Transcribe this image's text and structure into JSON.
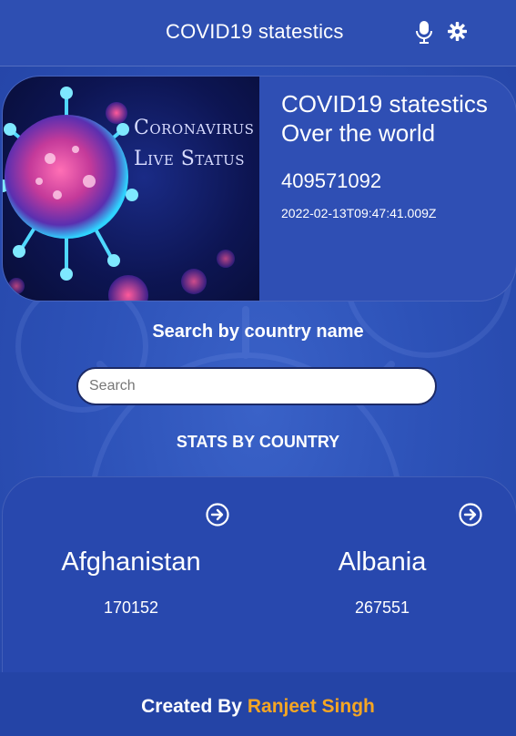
{
  "header": {
    "title": "COVID19 statestics",
    "mic_icon": "microphone-icon",
    "settings_icon": "gear-icon"
  },
  "hero": {
    "banner_line1": "Coronavirus",
    "banner_line2": "Live Status",
    "heading_line1": "COVID19 statestics",
    "heading_line2": "Over the world",
    "total_cases": "409571092",
    "updated": "2022-02-13T09:47:41.009Z"
  },
  "search": {
    "label": "Search by country name",
    "placeholder": "Search",
    "value": ""
  },
  "stats": {
    "label": "STATS BY COUNTRY",
    "countries": [
      {
        "name": "Afghanistan",
        "cases": "170152",
        "icon": "arrow-right-circle-icon"
      },
      {
        "name": "Albania",
        "cases": "267551",
        "icon": "arrow-right-circle-icon"
      }
    ]
  },
  "footer": {
    "prefix": "Created By",
    "author": "Ranjeet Singh"
  },
  "colors": {
    "background": "#2d52b8",
    "header": "#2e4fb2",
    "accent": "#f5a623",
    "text": "#ffffff"
  }
}
